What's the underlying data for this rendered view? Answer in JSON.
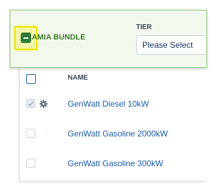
{
  "bundle": {
    "name": "AMIA BUNDLE",
    "tier_label": "TIER",
    "tier_select_value": "Please Select"
  },
  "table": {
    "columns": [
      "NAME"
    ],
    "rows": [
      {
        "name": "GenWatt Diesel 10kW",
        "checked": true,
        "has_config": true
      },
      {
        "name": "GenWatt Gasoline 2000kW",
        "checked": false,
        "has_config": false
      },
      {
        "name": "GenWatt Gasoline 300kW",
        "checked": false,
        "has_config": false
      }
    ]
  },
  "colors": {
    "bundle_accent": "#3c7a2c",
    "bundle_bg": "#f3f8ee",
    "link": "#1e5aa8",
    "highlight": "#e6e61a"
  },
  "icons": {
    "bundle_toggle": "minus-square-icon",
    "row_config": "gear-icon",
    "row_checked": "check-icon"
  }
}
